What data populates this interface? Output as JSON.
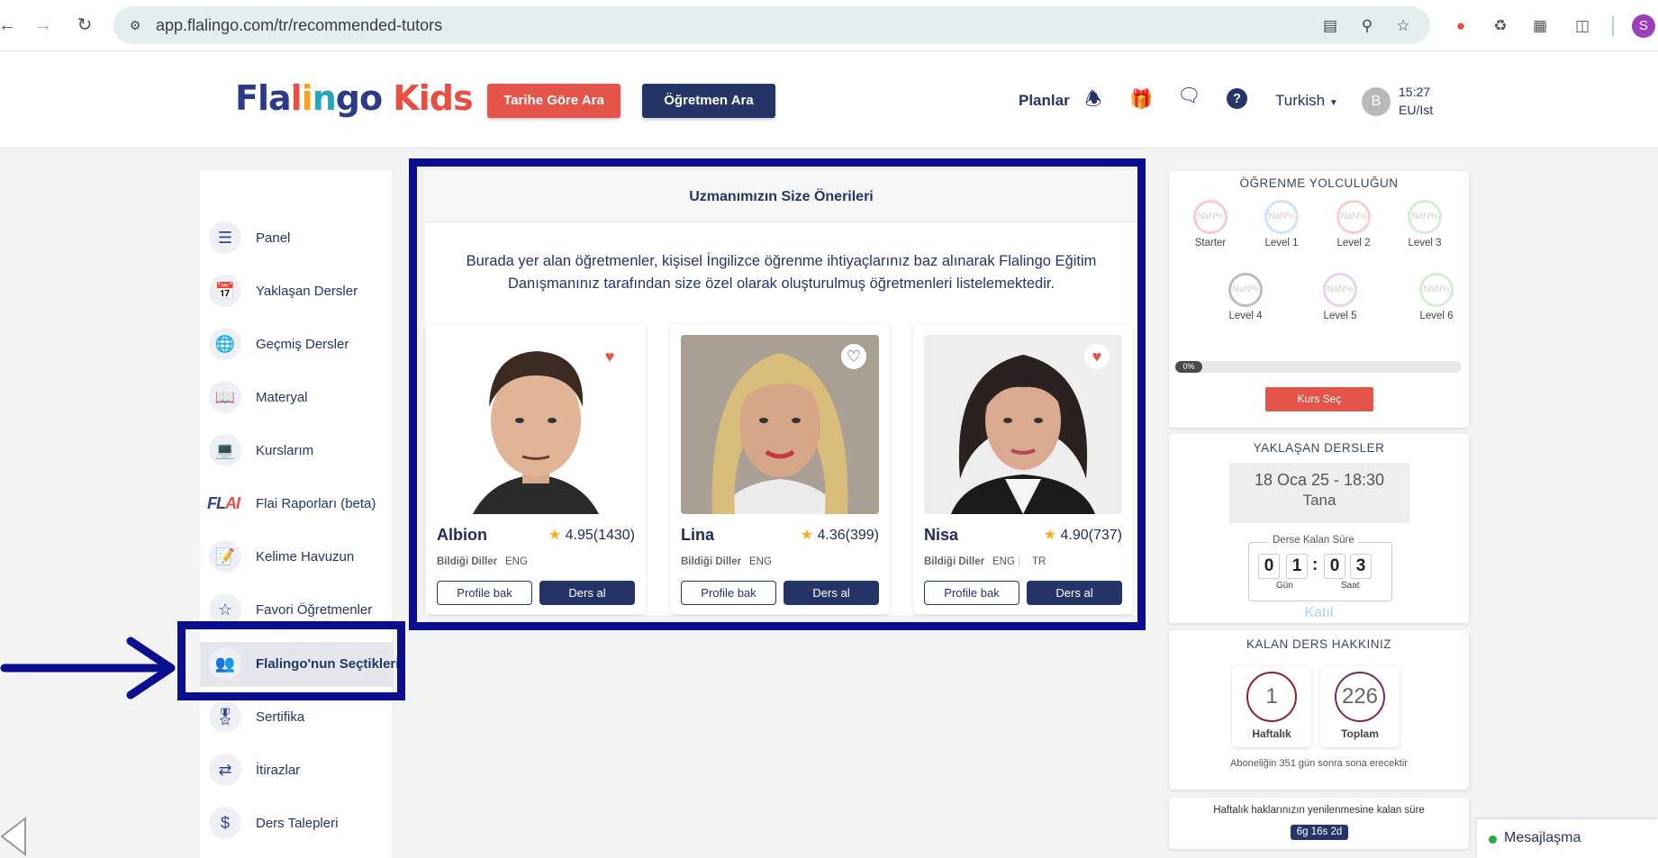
{
  "browser": {
    "url": "app.flalingo.com/tr/recommended-tutors",
    "profile_initial": "S"
  },
  "header": {
    "logo": {
      "part1": "Fla",
      "part2": "l",
      "part3": "i",
      "part4": "n",
      "part5": "go",
      "part6": " Kids"
    },
    "search_by_date": "Tarihe Göre Ara",
    "search_teacher": "Öğretmen Ara",
    "plans": "Planlar",
    "language": "Turkish",
    "avatar_initial": "B",
    "time": "15:27",
    "timezone": "EU/Ist"
  },
  "sidebar": {
    "items": [
      {
        "label": "Panel",
        "icon": "clipboard-icon"
      },
      {
        "label": "Yaklaşan Dersler",
        "icon": "calendar-icon"
      },
      {
        "label": "Geçmiş Dersler",
        "icon": "globe-icon"
      },
      {
        "label": "Materyal",
        "icon": "book-icon"
      },
      {
        "label": "Kurslarım",
        "icon": "monitor-icon"
      },
      {
        "label": "Flai Raporları (beta)",
        "icon": "flai-logo"
      },
      {
        "label": "Kelime Havuzun",
        "icon": "wordbook-icon"
      },
      {
        "label": "Favori Öğretmenler",
        "icon": "star-doc-icon"
      },
      {
        "label": "Flalingo'nun Seçtikleri",
        "icon": "team-icon"
      },
      {
        "label": "Sertifika",
        "icon": "certificate-icon"
      },
      {
        "label": "İtirazlar",
        "icon": "objection-icon"
      },
      {
        "label": "Ders Talepleri",
        "icon": "request-icon"
      }
    ],
    "flai_logo": {
      "a": "FL",
      "b": "AI"
    }
  },
  "main": {
    "title": "Uzmanımızın Size Önerileri",
    "description": "Burada yer alan öğretmenler, kişisel İngilizce öğrenme ihtiyaçlarınız baz alınarak Flalingo Eğitim Danışmanınız tarafından size özel olarak oluşturulmuş öğretmenleri listelemektedir.",
    "languages_label": "Bildiği Diller",
    "profile_button": "Profile bak",
    "lesson_button": "Ders al",
    "tutors": [
      {
        "name": "Albion",
        "rating": "4.95",
        "count": "(1430)",
        "langs": [
          "ENG"
        ],
        "favorite": true
      },
      {
        "name": "Lina",
        "rating": "4.36",
        "count": "(399)",
        "langs": [
          "ENG"
        ],
        "favorite": false
      },
      {
        "name": "Nisa",
        "rating": "4.90",
        "count": "(737)",
        "langs": [
          "ENG",
          "TR"
        ],
        "favorite": true
      }
    ]
  },
  "journey": {
    "title": "ÖĞRENME YOLCULUĞUN",
    "ring_value": "NaN%",
    "levels": [
      "Starter",
      "Level 1",
      "Level 2",
      "Level 3",
      "Level 4",
      "Level 5",
      "Level 6"
    ],
    "level_colors": [
      "#f7c9d2",
      "#cfe3f7",
      "#f7cfcf",
      "#d5ecd6",
      "#bdbdbd",
      "#ead3ef",
      "#d5ecd6"
    ],
    "progress": "0%",
    "progress_value": 0,
    "course_button": "Kurs Seç"
  },
  "upcoming": {
    "title": "YAKLAŞAN DERSLER",
    "date": "18 Oca 25 - 18:30",
    "teacher": "Tana",
    "countdown_label": "Derse Kalan Süre",
    "digits": [
      "0",
      "1",
      "0",
      "3"
    ],
    "day_label": "Gün",
    "hour_label": "Saat",
    "join": "Katıl"
  },
  "credits": {
    "title": "KALAN DERS HAKKINIZ",
    "weekly_value": "1",
    "weekly_label": "Haftalık",
    "total_value": "226",
    "total_label": "Toplam",
    "note": "Aboneliğin 351 gün sonra sona erecektir"
  },
  "refresh": {
    "note": "Haftalık haklarınızın yenilenmesine kalan süre",
    "badge": "6g 16s 2d"
  },
  "messaging": {
    "label": "Mesajlaşma"
  }
}
